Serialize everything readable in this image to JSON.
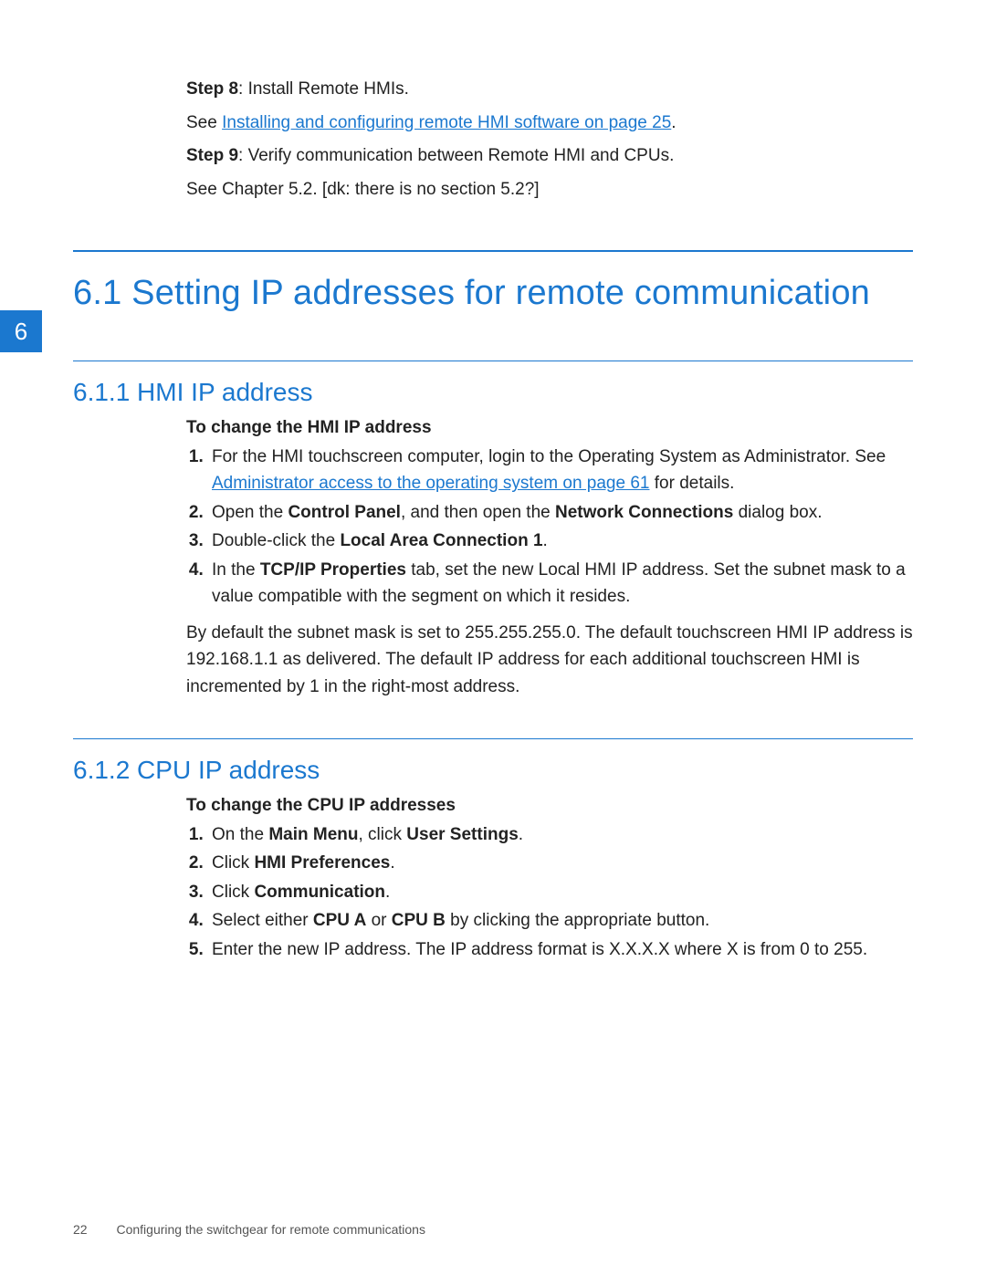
{
  "chapter_tab": "6",
  "intro": {
    "step8_label": "Step 8",
    "step8_text": ": Install Remote HMIs.",
    "see1_prefix": "See ",
    "see1_link": "Installing and configuring remote HMI software on page 25",
    "see1_suffix": ".",
    "step9_label": "Step 9",
    "step9_text": ": Verify communication between Remote HMI and CPUs.",
    "see2": "See Chapter 5.2. [dk: there is no section 5.2?]"
  },
  "section": {
    "title": "6.1 Setting IP addresses for remote communication"
  },
  "sub1": {
    "title": "6.1.1 HMI IP address",
    "proc_title": "To change the HMI IP address",
    "li1_a": "For the HMI touchscreen computer, login to the Operating System as Administrator. See ",
    "li1_link": "Administrator access to the operating system on page 61",
    "li1_b": " for details.",
    "li2_a": "Open the ",
    "li2_b1": "Control Panel",
    "li2_c": ", and then open the ",
    "li2_b2": "Network Connections",
    "li2_d": " dialog box.",
    "li3_a": "Double-click the ",
    "li3_b": "Local Area Connection 1",
    "li3_c": ".",
    "li4_a": "In the ",
    "li4_b": "TCP/IP Properties",
    "li4_c": " tab, set the new Local HMI IP address. Set the subnet mask to a value compatible with the segment on which it resides.",
    "note": "By default the subnet mask is set to 255.255.255.0. The default touchscreen HMI IP address is 192.168.1.1 as delivered. The default IP address for each additional touchscreen HMI is incremented by 1 in the right-most address."
  },
  "sub2": {
    "title": "6.1.2 CPU IP address",
    "proc_title": "To change the CPU IP addresses",
    "li1_a": "On the ",
    "li1_b1": "Main Menu",
    "li1_c": ", click ",
    "li1_b2": "User Settings",
    "li1_d": ".",
    "li2_a": "Click ",
    "li2_b": "HMI Preferences",
    "li2_c": ".",
    "li3_a": "Click ",
    "li3_b": "Communication",
    "li3_c": ".",
    "li4_a": "Select either ",
    "li4_b1": "CPU A",
    "li4_c": " or ",
    "li4_b2": "CPU B",
    "li4_d": " by clicking the appropriate button.",
    "li5": "Enter the new IP address. The IP address format is X.X.X.X where X is from 0 to 255."
  },
  "footer": {
    "page": "22",
    "text": "Configuring the switchgear for remote communications"
  }
}
